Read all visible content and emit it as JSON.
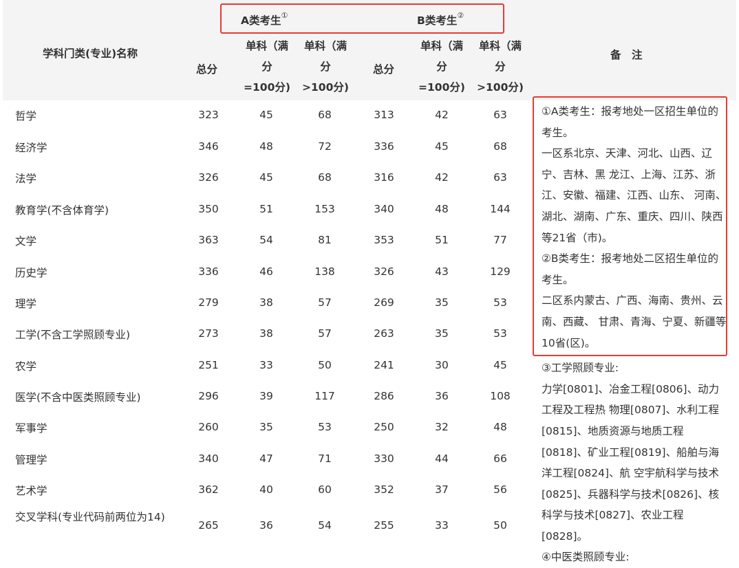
{
  "header": {
    "col_name": "学科门类(专业)名称",
    "group_a": "A类考生",
    "group_a_mark": "①",
    "group_b": "B类考生",
    "group_b_mark": "②",
    "total": "总分",
    "single100_l1": "单科（满",
    "single100_l2": "分",
    "single100_l3": "=100分)",
    "singleGT_l1": "单科（满",
    "singleGT_l2": "分",
    "singleGT_l3": ">100分)",
    "notes": "备　注"
  },
  "rows": [
    {
      "name": "哲学",
      "a_total": "323",
      "a_s1": "45",
      "a_s2": "68",
      "b_total": "313",
      "b_s1": "42",
      "b_s2": "63"
    },
    {
      "name": "经济学",
      "a_total": "346",
      "a_s1": "48",
      "a_s2": "72",
      "b_total": "336",
      "b_s1": "45",
      "b_s2": "68"
    },
    {
      "name": "法学",
      "a_total": "326",
      "a_s1": "45",
      "a_s2": "68",
      "b_total": "316",
      "b_s1": "42",
      "b_s2": "63"
    },
    {
      "name": "教育学(不含体育学)",
      "a_total": "350",
      "a_s1": "51",
      "a_s2": "153",
      "b_total": "340",
      "b_s1": "48",
      "b_s2": "144"
    },
    {
      "name": "文学",
      "a_total": "363",
      "a_s1": "54",
      "a_s2": "81",
      "b_total": "353",
      "b_s1": "51",
      "b_s2": "77"
    },
    {
      "name": "历史学",
      "a_total": "336",
      "a_s1": "46",
      "a_s2": "138",
      "b_total": "326",
      "b_s1": "43",
      "b_s2": "129"
    },
    {
      "name": "理学",
      "a_total": "279",
      "a_s1": "38",
      "a_s2": "57",
      "b_total": "269",
      "b_s1": "35",
      "b_s2": "53"
    },
    {
      "name": "工学(不含工学照顾专业)",
      "a_total": "273",
      "a_s1": "38",
      "a_s2": "57",
      "b_total": "263",
      "b_s1": "35",
      "b_s2": "53"
    },
    {
      "name": "农学",
      "a_total": "251",
      "a_s1": "33",
      "a_s2": "50",
      "b_total": "241",
      "b_s1": "30",
      "b_s2": "45"
    },
    {
      "name": "医学(不含中医类照顾专业)",
      "a_total": "296",
      "a_s1": "39",
      "a_s2": "117",
      "b_total": "286",
      "b_s1": "36",
      "b_s2": "108"
    },
    {
      "name": "军事学",
      "a_total": "260",
      "a_s1": "35",
      "a_s2": "53",
      "b_total": "250",
      "b_s1": "32",
      "b_s2": "48"
    },
    {
      "name": "管理学",
      "a_total": "340",
      "a_s1": "47",
      "a_s2": "71",
      "b_total": "330",
      "b_s1": "44",
      "b_s2": "66"
    },
    {
      "name": "艺术学",
      "a_total": "362",
      "a_s1": "40",
      "a_s2": "60",
      "b_total": "352",
      "b_s1": "37",
      "b_s2": "56"
    },
    {
      "name": "交叉学科(专业代码前两位为14)",
      "a_total": "265",
      "a_s1": "36",
      "a_s2": "54",
      "b_total": "255",
      "b_s1": "33",
      "b_s2": "50"
    }
  ],
  "notes": {
    "a_def": "①A类考生：报考地处一区招生单位的考生。",
    "zone1": "一区系北京、天津、河北、山西、辽宁、吉林、黑 龙江、上海、江苏、浙江、安徽、福建、江西、山东、 河南、湖北、湖南、广东、重庆、四川、陕西等21省（市)。",
    "b_def": "②B类考生：报考地处二区招生单位的考生。",
    "zone2": "二区系内蒙古、广西、海南、贵州、云南、西藏、 甘肃、青海、宁夏、新疆等10省(区)。",
    "eng_title": "③工学照顾专业:",
    "eng_list": "力学[0801]、冶金工程[0806]、动力工程及工程热 物理[0807]、水利工程[0815]、地质资源与地质工程 [0818]、矿业工程[0819]、船舶与海洋工程[0824]、航 空宇航科学与技术[0825]、兵器科学与技术[0826]、核 科学与技术[0827]、农业工程[0828]。",
    "tcm_title": "④中医类照顾专业:"
  },
  "colors": {
    "highlight_border": "#e53935",
    "header_bg": "#f4f4f4",
    "text": "#333333"
  }
}
